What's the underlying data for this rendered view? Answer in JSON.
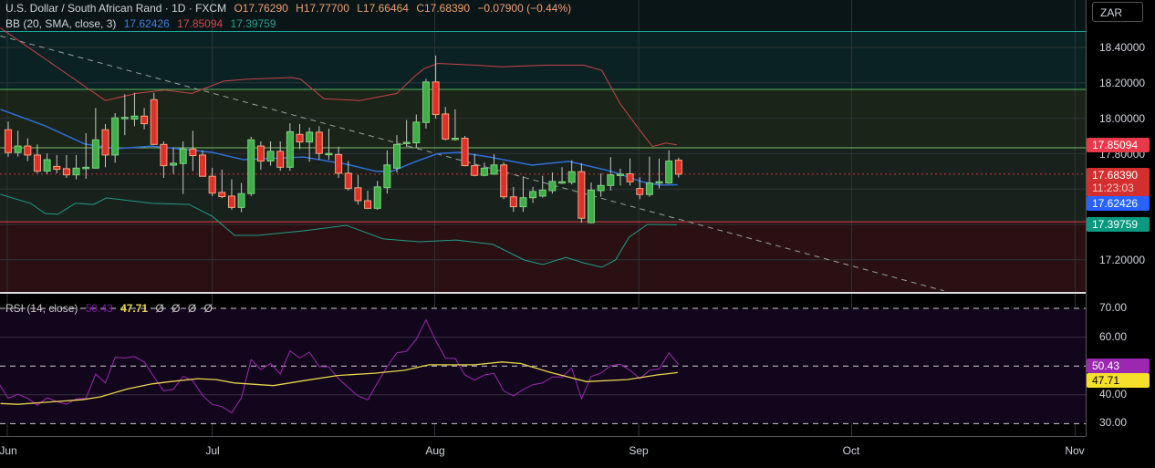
{
  "header": {
    "symbol": "U.S. Dollar / South African Rand · 1D · FXCM",
    "open": "O17.76290",
    "high": "H17.77700",
    "low": "L17.66464",
    "close": "C17.68390",
    "change": "−0.07900 (−0.44%)"
  },
  "bb": {
    "label": "BB (20, SMA, close, 3)",
    "basis": "17.62426",
    "upper": "17.85094",
    "lower": "17.39759"
  },
  "rsi": {
    "label": "RSI (14, close)",
    "value": "50.43",
    "ma": "47.71",
    "extra": [
      "Ø",
      "Ø",
      "Ø",
      "Ø"
    ]
  },
  "currency_button": "ZAR",
  "price_axis": {
    "ticks": [
      "18.40000",
      "18.20000",
      "18.00000",
      "17.80000",
      "17.20000"
    ],
    "tags": {
      "upper": "17.85094",
      "last": "17.68390",
      "countdown": "11:23:03",
      "basis": "17.62426",
      "lower": "17.39759"
    }
  },
  "rsi_axis": {
    "ticks": [
      "70.00",
      "60.00",
      "40.00",
      "30.00"
    ],
    "tags": {
      "rsi": "50.43",
      "ma": "47.71"
    }
  },
  "time_axis": {
    "labels": [
      "Jun",
      "Jul",
      "Aug",
      "Sep",
      "Oct",
      "Nov"
    ]
  },
  "colors": {
    "up": "#3fae49",
    "down": "#e0302a",
    "bb_upper": "#c8434a",
    "bb_basis": "#2f6fd6",
    "bb_lower": "#1f9c88",
    "rsi": "#9c27b0",
    "rsi_ma": "#e8d44d"
  },
  "chart_data": {
    "type": "candlestick",
    "price_range": [
      17.1,
      18.5
    ],
    "month_ticks": [
      {
        "label": "Jun",
        "bar": -0.1
      },
      {
        "label": "Jul",
        "bar": 21
      },
      {
        "label": "Aug",
        "bar": 43.9
      },
      {
        "label": "Sep",
        "bar": 64.9
      },
      {
        "label": "Oct",
        "bar": 86.8
      },
      {
        "label": "Nov",
        "bar": 109.8
      }
    ],
    "levels": [
      18.49,
      18.163,
      17.833,
      17.415
    ],
    "candles_ohlc": [
      [
        17.935,
        17.981,
        17.783,
        17.806
      ],
      [
        17.806,
        17.929,
        17.783,
        17.843
      ],
      [
        17.843,
        17.886,
        17.758,
        17.792
      ],
      [
        17.792,
        17.852,
        17.689,
        17.701
      ],
      [
        17.701,
        17.801,
        17.685,
        17.766
      ],
      [
        17.728,
        17.792,
        17.689,
        17.711
      ],
      [
        17.715,
        17.792,
        17.663,
        17.68
      ],
      [
        17.68,
        17.792,
        17.654,
        17.718
      ],
      [
        17.72,
        17.916,
        17.658,
        17.723
      ],
      [
        17.718,
        18.058,
        17.715,
        17.878
      ],
      [
        17.935,
        17.967,
        17.723,
        17.792
      ],
      [
        17.792,
        18.029,
        17.749,
        18.002
      ],
      [
        18.0,
        18.136,
        17.904,
        18.005
      ],
      [
        17.995,
        18.144,
        17.955,
        18.012
      ],
      [
        18.012,
        18.058,
        17.938,
        17.969
      ],
      [
        18.105,
        18.144,
        17.849,
        17.852
      ],
      [
        17.852,
        17.869,
        17.663,
        17.732
      ],
      [
        17.735,
        17.835,
        17.685,
        17.746
      ],
      [
        17.744,
        17.869,
        17.572,
        17.826
      ],
      [
        17.826,
        17.929,
        17.701,
        17.789
      ],
      [
        17.792,
        17.818,
        17.672,
        17.672
      ],
      [
        17.672,
        17.72,
        17.56,
        17.577
      ],
      [
        17.581,
        17.71,
        17.548,
        17.557
      ],
      [
        17.56,
        17.655,
        17.483,
        17.496
      ],
      [
        17.496,
        17.634,
        17.469,
        17.574
      ],
      [
        17.574,
        17.895,
        17.56,
        17.878
      ],
      [
        17.843,
        17.869,
        17.709,
        17.758
      ],
      [
        17.758,
        17.869,
        17.732,
        17.813
      ],
      [
        17.813,
        17.869,
        17.703,
        17.723
      ],
      [
        17.723,
        17.972,
        17.703,
        17.924
      ],
      [
        17.909,
        17.967,
        17.826,
        17.866
      ],
      [
        17.866,
        17.947,
        17.754,
        17.921
      ],
      [
        17.921,
        17.955,
        17.766,
        17.801
      ],
      [
        17.801,
        17.941,
        17.766,
        17.801
      ],
      [
        17.795,
        17.84,
        17.663,
        17.689
      ],
      [
        17.689,
        17.758,
        17.591,
        17.603
      ],
      [
        17.607,
        17.68,
        17.512,
        17.534
      ],
      [
        17.534,
        17.591,
        17.488,
        17.491
      ],
      [
        17.491,
        17.646,
        17.483,
        17.612
      ],
      [
        17.608,
        17.818,
        17.574,
        17.736
      ],
      [
        17.718,
        17.904,
        17.692,
        17.852
      ],
      [
        17.857,
        17.99,
        17.838,
        17.864
      ],
      [
        17.861,
        18.021,
        17.832,
        17.978
      ],
      [
        17.976,
        18.222,
        17.942,
        18.205
      ],
      [
        18.205,
        18.354,
        17.998,
        18.021
      ],
      [
        18.024,
        18.064,
        17.875,
        17.882
      ],
      [
        17.887,
        18.05,
        17.873,
        17.887
      ],
      [
        17.887,
        17.9,
        17.729,
        17.732
      ],
      [
        17.732,
        17.8,
        17.672,
        17.677
      ],
      [
        17.677,
        17.749,
        17.672,
        17.718
      ],
      [
        17.684,
        17.797,
        17.68,
        17.736
      ],
      [
        17.736,
        17.752,
        17.543,
        17.556
      ],
      [
        17.556,
        17.612,
        17.471,
        17.5
      ],
      [
        17.5,
        17.672,
        17.471,
        17.551
      ],
      [
        17.551,
        17.612,
        17.522,
        17.586
      ],
      [
        17.56,
        17.675,
        17.551,
        17.594
      ],
      [
        17.591,
        17.694,
        17.574,
        17.643
      ],
      [
        17.641,
        17.723,
        17.629,
        17.641
      ],
      [
        17.638,
        17.763,
        17.626,
        17.698
      ],
      [
        17.698,
        17.746,
        17.409,
        17.435
      ],
      [
        17.41,
        17.637,
        17.406,
        17.594
      ],
      [
        17.591,
        17.689,
        17.557,
        17.62
      ],
      [
        17.62,
        17.78,
        17.591,
        17.68
      ],
      [
        17.684,
        17.715,
        17.62,
        17.684
      ],
      [
        17.686,
        17.772,
        17.62,
        17.641
      ],
      [
        17.603,
        17.667,
        17.543,
        17.569
      ],
      [
        17.569,
        17.783,
        17.557,
        17.634
      ],
      [
        17.638,
        17.772,
        17.603,
        17.641
      ],
      [
        17.634,
        17.818,
        17.629,
        17.758
      ],
      [
        17.7629,
        17.777,
        17.66464,
        17.6839
      ]
    ],
    "bb_upper": [
      [
        -0.8,
        18.51
      ],
      [
        7.1,
        18.21
      ],
      [
        10,
        18.1
      ],
      [
        13.2,
        18.14
      ],
      [
        16.1,
        18.16
      ],
      [
        18.9,
        18.14
      ],
      [
        22.2,
        18.21
      ],
      [
        24.5,
        18.22
      ],
      [
        29.2,
        18.23
      ],
      [
        30.1,
        18.22
      ],
      [
        32.5,
        18.11
      ],
      [
        36.2,
        18.1
      ],
      [
        38.1,
        18.12
      ],
      [
        40,
        18.14
      ],
      [
        41.9,
        18.24
      ],
      [
        42.8,
        18.28
      ],
      [
        44.2,
        18.31
      ],
      [
        48,
        18.3
      ],
      [
        50.8,
        18.29
      ],
      [
        55.5,
        18.3
      ],
      [
        59.2,
        18.3
      ],
      [
        61.1,
        18.27
      ],
      [
        63,
        18.08
      ],
      [
        64.9,
        17.94
      ],
      [
        66.3,
        17.84
      ],
      [
        67.7,
        17.86
      ],
      [
        68.8,
        17.85
      ]
    ],
    "bb_basis": [
      [
        -0.8,
        18.05
      ],
      [
        3.8,
        17.957
      ],
      [
        7.9,
        17.854
      ],
      [
        11.1,
        17.828
      ],
      [
        14.8,
        17.843
      ],
      [
        21,
        17.807
      ],
      [
        24.2,
        17.766
      ],
      [
        30.4,
        17.781
      ],
      [
        34.8,
        17.74
      ],
      [
        37.9,
        17.7
      ],
      [
        39.5,
        17.7
      ],
      [
        41.7,
        17.75
      ],
      [
        44.2,
        17.8
      ],
      [
        46.4,
        17.807
      ],
      [
        49.6,
        17.78
      ],
      [
        53.9,
        17.735
      ],
      [
        57.7,
        17.756
      ],
      [
        62.1,
        17.7
      ],
      [
        65.2,
        17.642
      ],
      [
        67,
        17.622
      ],
      [
        68.9,
        17.624
      ]
    ],
    "bb_lower": [
      [
        -0.8,
        17.57
      ],
      [
        2.3,
        17.519
      ],
      [
        3.8,
        17.462
      ],
      [
        5.1,
        17.457
      ],
      [
        6.9,
        17.519
      ],
      [
        8.8,
        17.513
      ],
      [
        10.1,
        17.55
      ],
      [
        14.8,
        17.519
      ],
      [
        18.6,
        17.513
      ],
      [
        21,
        17.446
      ],
      [
        23.3,
        17.338
      ],
      [
        25.7,
        17.338
      ],
      [
        30.4,
        17.364
      ],
      [
        34.8,
        17.395
      ],
      [
        38.6,
        17.318
      ],
      [
        42.3,
        17.302
      ],
      [
        46.1,
        17.312
      ],
      [
        49.9,
        17.287
      ],
      [
        53.1,
        17.199
      ],
      [
        55,
        17.173
      ],
      [
        57.4,
        17.214
      ],
      [
        59.2,
        17.183
      ],
      [
        61.1,
        17.158
      ],
      [
        62.5,
        17.199
      ],
      [
        63.9,
        17.328
      ],
      [
        65.8,
        17.4
      ],
      [
        68.8,
        17.398
      ]
    ],
    "trendline": [
      [
        -0.8,
        18.465
      ],
      [
        96.3,
        17.025
      ]
    ],
    "rsi_start_bar": -1,
    "rsi_values": [
      44.1,
      38.8,
      40.2,
      38.8,
      36.4,
      39,
      37.7,
      36.7,
      38.6,
      38.8,
      47.2,
      44.1,
      53,
      52.8,
      53.3,
      51.4,
      46.2,
      41.4,
      41.9,
      46.4,
      44.9,
      39.8,
      36.7,
      35.9,
      33.8,
      39,
      52.2,
      48.8,
      50.9,
      47.2,
      55.3,
      52.8,
      54.8,
      49.8,
      49.7,
      45.6,
      42.5,
      39.6,
      38.3,
      44.1,
      49.8,
      54.6,
      55.1,
      59.3,
      66,
      58.8,
      52.7,
      52.7,
      46.9,
      45.1,
      46.9,
      47.4,
      41.4,
      39.6,
      41.9,
      43.5,
      44.1,
      46.2,
      46.2,
      49.3,
      38.6,
      46.4,
      47.5,
      50.1,
      50.6,
      48.5,
      45.6,
      48.5,
      49,
      54.6,
      50.43
    ],
    "rsi_ma": [
      [
        -0.8,
        37
      ],
      [
        1,
        36.7
      ],
      [
        3.8,
        37.4
      ],
      [
        7.6,
        38.3
      ],
      [
        9.5,
        39.3
      ],
      [
        12.3,
        42.1
      ],
      [
        14.8,
        43.8
      ],
      [
        16.7,
        44.6
      ],
      [
        19.5,
        45.6
      ],
      [
        21.4,
        45.3
      ],
      [
        23.3,
        44.1
      ],
      [
        27.3,
        43.2
      ],
      [
        30.4,
        44.9
      ],
      [
        33.9,
        46.7
      ],
      [
        37.7,
        47.5
      ],
      [
        40.8,
        48.5
      ],
      [
        43.3,
        50.4
      ],
      [
        48,
        50.4
      ],
      [
        50.8,
        51.4
      ],
      [
        52.7,
        50.9
      ],
      [
        55.8,
        47.8
      ],
      [
        59.5,
        44.6
      ],
      [
        63.7,
        45.3
      ],
      [
        66.8,
        46.9
      ],
      [
        68.9,
        47.71
      ]
    ],
    "rsi_levels": [
      70,
      50,
      30
    ],
    "rsi_range": [
      25,
      75
    ]
  }
}
